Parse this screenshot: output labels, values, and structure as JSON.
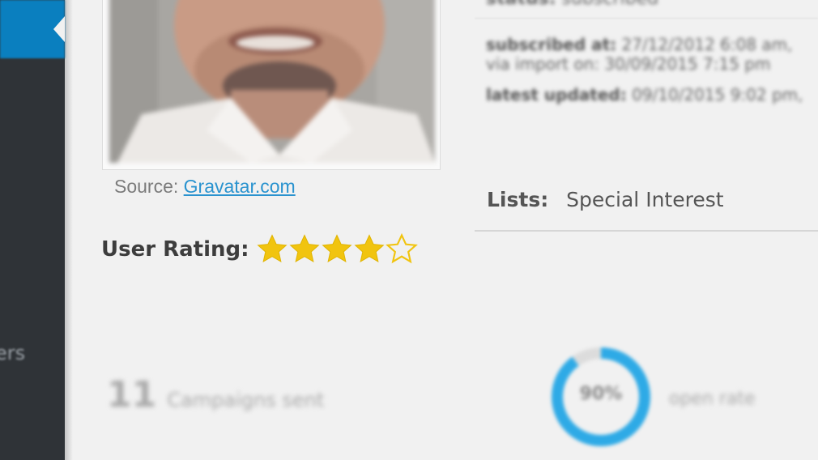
{
  "sidebar": {
    "partial_item_label": "ers"
  },
  "profile": {
    "source_prefix": "Source:",
    "source_link": "Gravatar.com"
  },
  "rating": {
    "label": "User Rating:",
    "value": 4,
    "max": 5,
    "star_color": "#f1c40f"
  },
  "meta": {
    "status_label": "status:",
    "status_value": "subscribed",
    "subscribed_label": "subscribed at:",
    "subscribed_value": "27/12/2012 6:08 am,",
    "import_text": "via import on: 30/09/2015 7:15 pm",
    "updated_label": "latest updated:",
    "updated_value": "09/10/2015 9:02 pm,"
  },
  "lists": {
    "label": "Lists:",
    "value": "Special Interest"
  },
  "stats": {
    "campaigns_count": "11",
    "campaigns_label": "Campaigns sent",
    "open_rate_pct": "90%",
    "open_rate_value": 0.9,
    "open_rate_label": "open rate",
    "open_rate_color": "#2eaae6"
  },
  "colors": {
    "sidebar_bg": "#2f3337",
    "sidebar_active": "#0a7fbf",
    "link": "#2a93cf",
    "page_bg": "#f1f1f1"
  }
}
